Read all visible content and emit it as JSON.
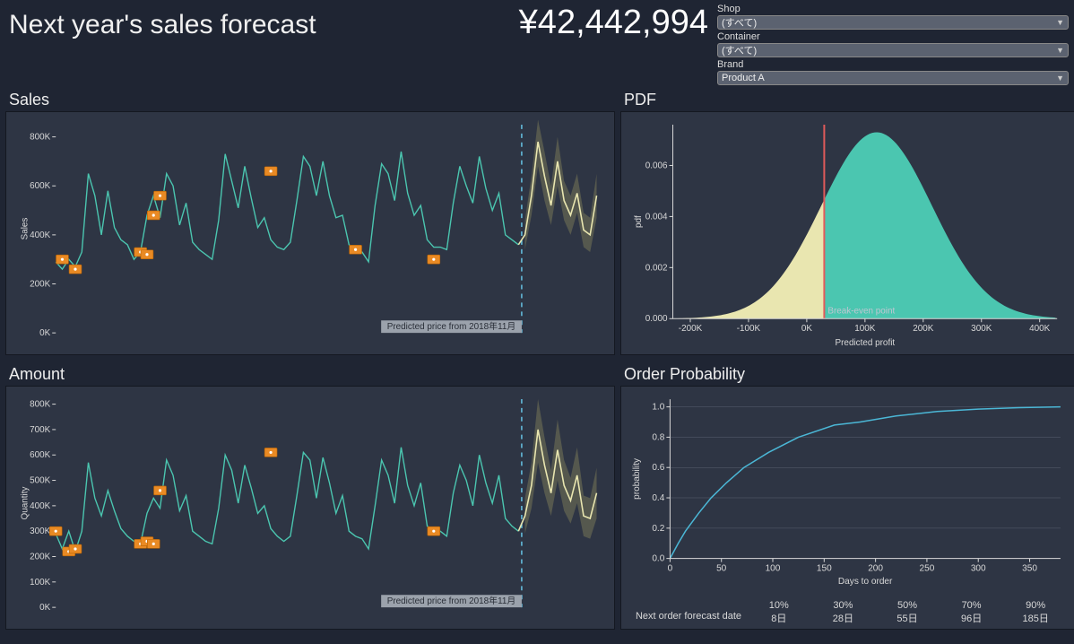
{
  "header": {
    "title": "Next year's sales forecast",
    "total": "¥42,442,994"
  },
  "filters": {
    "shop": {
      "label": "Shop",
      "value": "(すべて)"
    },
    "container": {
      "label": "Container",
      "value": "(すべて)"
    },
    "brand": {
      "label": "Brand",
      "value": "Product A"
    }
  },
  "panels": {
    "sales": {
      "title": "Sales",
      "ylabel": "Sales",
      "note": "Predicted price from 2018年11月"
    },
    "amount": {
      "title": "Amount",
      "ylabel": "Quantity",
      "note": "Predicted price from 2018年11月"
    },
    "pdf": {
      "title": "PDF",
      "xlabel": "Predicted profit",
      "ylabel": "pdf",
      "be_label": "Break-even point"
    },
    "order": {
      "title": "Order Probability",
      "xlabel": "Days to order",
      "ylabel": "probability",
      "table_label": "Next order forecast date",
      "percent_labels": [
        "10%",
        "30%",
        "50%",
        "70%",
        "90%"
      ],
      "day_labels": [
        "8日",
        "28日",
        "55日",
        "96日",
        "185日"
      ]
    }
  },
  "chart_data": [
    {
      "id": "sales",
      "type": "line",
      "ylabel": "Sales",
      "y_ticks": [
        "0K",
        "200K",
        "400K",
        "600K",
        "800K"
      ],
      "ylim": [
        0,
        850000
      ],
      "forecast_split_index": 72,
      "note": "Predicted price from 2018年11月",
      "series": [
        {
          "name": "historical",
          "color": "#4bc6b0",
          "values": [
            290,
            260,
            300,
            270,
            330,
            650,
            560,
            400,
            580,
            430,
            380,
            360,
            300,
            330,
            480,
            560,
            470,
            650,
            600,
            440,
            530,
            370,
            340,
            320,
            300,
            460,
            730,
            620,
            510,
            680,
            550,
            430,
            470,
            380,
            350,
            340,
            370,
            540,
            720,
            680,
            560,
            700,
            560,
            470,
            480,
            360,
            340,
            330,
            290,
            520,
            690,
            650,
            540,
            740,
            570,
            480,
            520,
            380,
            350,
            350,
            340,
            530,
            680,
            600,
            530,
            720,
            590,
            500,
            570,
            400,
            380,
            360
          ]
        },
        {
          "name": "forecast_mean",
          "color": "#e9e6b0",
          "values": [
            400,
            560,
            780,
            640,
            520,
            700,
            540,
            480,
            570,
            420,
            400,
            560
          ]
        },
        {
          "name": "forecast_band_lo",
          "values": [
            340,
            480,
            680,
            540,
            440,
            600,
            460,
            400,
            490,
            350,
            330,
            470
          ]
        },
        {
          "name": "forecast_band_hi",
          "values": [
            460,
            640,
            870,
            740,
            600,
            800,
            620,
            560,
            650,
            490,
            470,
            650
          ]
        }
      ],
      "markers": [
        {
          "i": 1,
          "v": 300
        },
        {
          "i": 3,
          "v": 260
        },
        {
          "i": 13,
          "v": 330
        },
        {
          "i": 14,
          "v": 320
        },
        {
          "i": 15,
          "v": 480
        },
        {
          "i": 16,
          "v": 560
        },
        {
          "i": 33,
          "v": 660
        },
        {
          "i": 46,
          "v": 340
        },
        {
          "i": 58,
          "v": 300
        }
      ]
    },
    {
      "id": "amount",
      "type": "line",
      "ylabel": "Quantity",
      "y_ticks": [
        "0K",
        "100K",
        "200K",
        "300K",
        "400K",
        "500K",
        "600K",
        "700K",
        "800K"
      ],
      "ylim": [
        0,
        820000
      ],
      "forecast_split_index": 72,
      "note": "Predicted price from 2018年11月",
      "series": [
        {
          "name": "historical",
          "color": "#4bc6b0",
          "values": [
            290,
            230,
            300,
            220,
            300,
            570,
            430,
            360,
            460,
            380,
            310,
            280,
            260,
            250,
            370,
            430,
            390,
            580,
            520,
            380,
            440,
            300,
            280,
            260,
            250,
            390,
            600,
            540,
            410,
            560,
            470,
            370,
            400,
            310,
            280,
            260,
            280,
            440,
            610,
            580,
            430,
            590,
            490,
            370,
            440,
            300,
            280,
            270,
            230,
            400,
            580,
            520,
            410,
            630,
            480,
            400,
            490,
            320,
            300,
            300,
            280,
            450,
            560,
            500,
            400,
            600,
            490,
            410,
            520,
            350,
            320,
            300
          ]
        },
        {
          "name": "forecast_mean",
          "color": "#e9e6b0",
          "values": [
            360,
            480,
            700,
            560,
            450,
            620,
            480,
            420,
            520,
            360,
            350,
            450
          ]
        },
        {
          "name": "forecast_band_lo",
          "values": [
            290,
            390,
            570,
            450,
            360,
            500,
            380,
            330,
            410,
            280,
            270,
            350
          ]
        },
        {
          "name": "forecast_band_hi",
          "values": [
            430,
            570,
            820,
            670,
            540,
            740,
            580,
            510,
            630,
            440,
            430,
            550
          ]
        }
      ],
      "markers": [
        {
          "i": 0,
          "v": 300
        },
        {
          "i": 2,
          "v": 220
        },
        {
          "i": 3,
          "v": 230
        },
        {
          "i": 13,
          "v": 250
        },
        {
          "i": 14,
          "v": 260
        },
        {
          "i": 15,
          "v": 250
        },
        {
          "i": 16,
          "v": 460
        },
        {
          "i": 33,
          "v": 610
        },
        {
          "i": 58,
          "v": 300
        }
      ]
    },
    {
      "id": "pdf",
      "type": "area",
      "xlabel": "Predicted profit",
      "ylabel": "pdf",
      "x_ticks": [
        "-200K",
        "-100K",
        "0K",
        "100K",
        "200K",
        "300K",
        "400K"
      ],
      "y_ticks": [
        "0.000",
        "0.002",
        "0.004",
        "0.006"
      ],
      "xlim": [
        -230000,
        430000
      ],
      "ylim": [
        0,
        0.0076
      ],
      "break_even_x": 30000,
      "mu": 120000,
      "sigma": 95000
    },
    {
      "id": "order_probability",
      "type": "line",
      "xlabel": "Days to order",
      "ylabel": "probability",
      "x_ticks": [
        "0",
        "50",
        "100",
        "150",
        "200",
        "250",
        "300",
        "350"
      ],
      "y_ticks": [
        "0.0",
        "0.2",
        "0.4",
        "0.6",
        "0.8",
        "1.0"
      ],
      "xlim": [
        0,
        380
      ],
      "ylim": [
        0,
        1.05
      ],
      "points": [
        [
          0,
          0.0
        ],
        [
          8,
          0.1
        ],
        [
          15,
          0.18
        ],
        [
          28,
          0.3
        ],
        [
          40,
          0.4
        ],
        [
          55,
          0.5
        ],
        [
          72,
          0.6
        ],
        [
          96,
          0.7
        ],
        [
          125,
          0.8
        ],
        [
          160,
          0.88
        ],
        [
          185,
          0.9
        ],
        [
          220,
          0.94
        ],
        [
          260,
          0.97
        ],
        [
          300,
          0.985
        ],
        [
          340,
          0.995
        ],
        [
          380,
          1.0
        ]
      ],
      "lookup": {
        "percent": [
          "10%",
          "30%",
          "50%",
          "70%",
          "90%"
        ],
        "days": [
          "8日",
          "28日",
          "55日",
          "96日",
          "185日"
        ]
      }
    }
  ]
}
